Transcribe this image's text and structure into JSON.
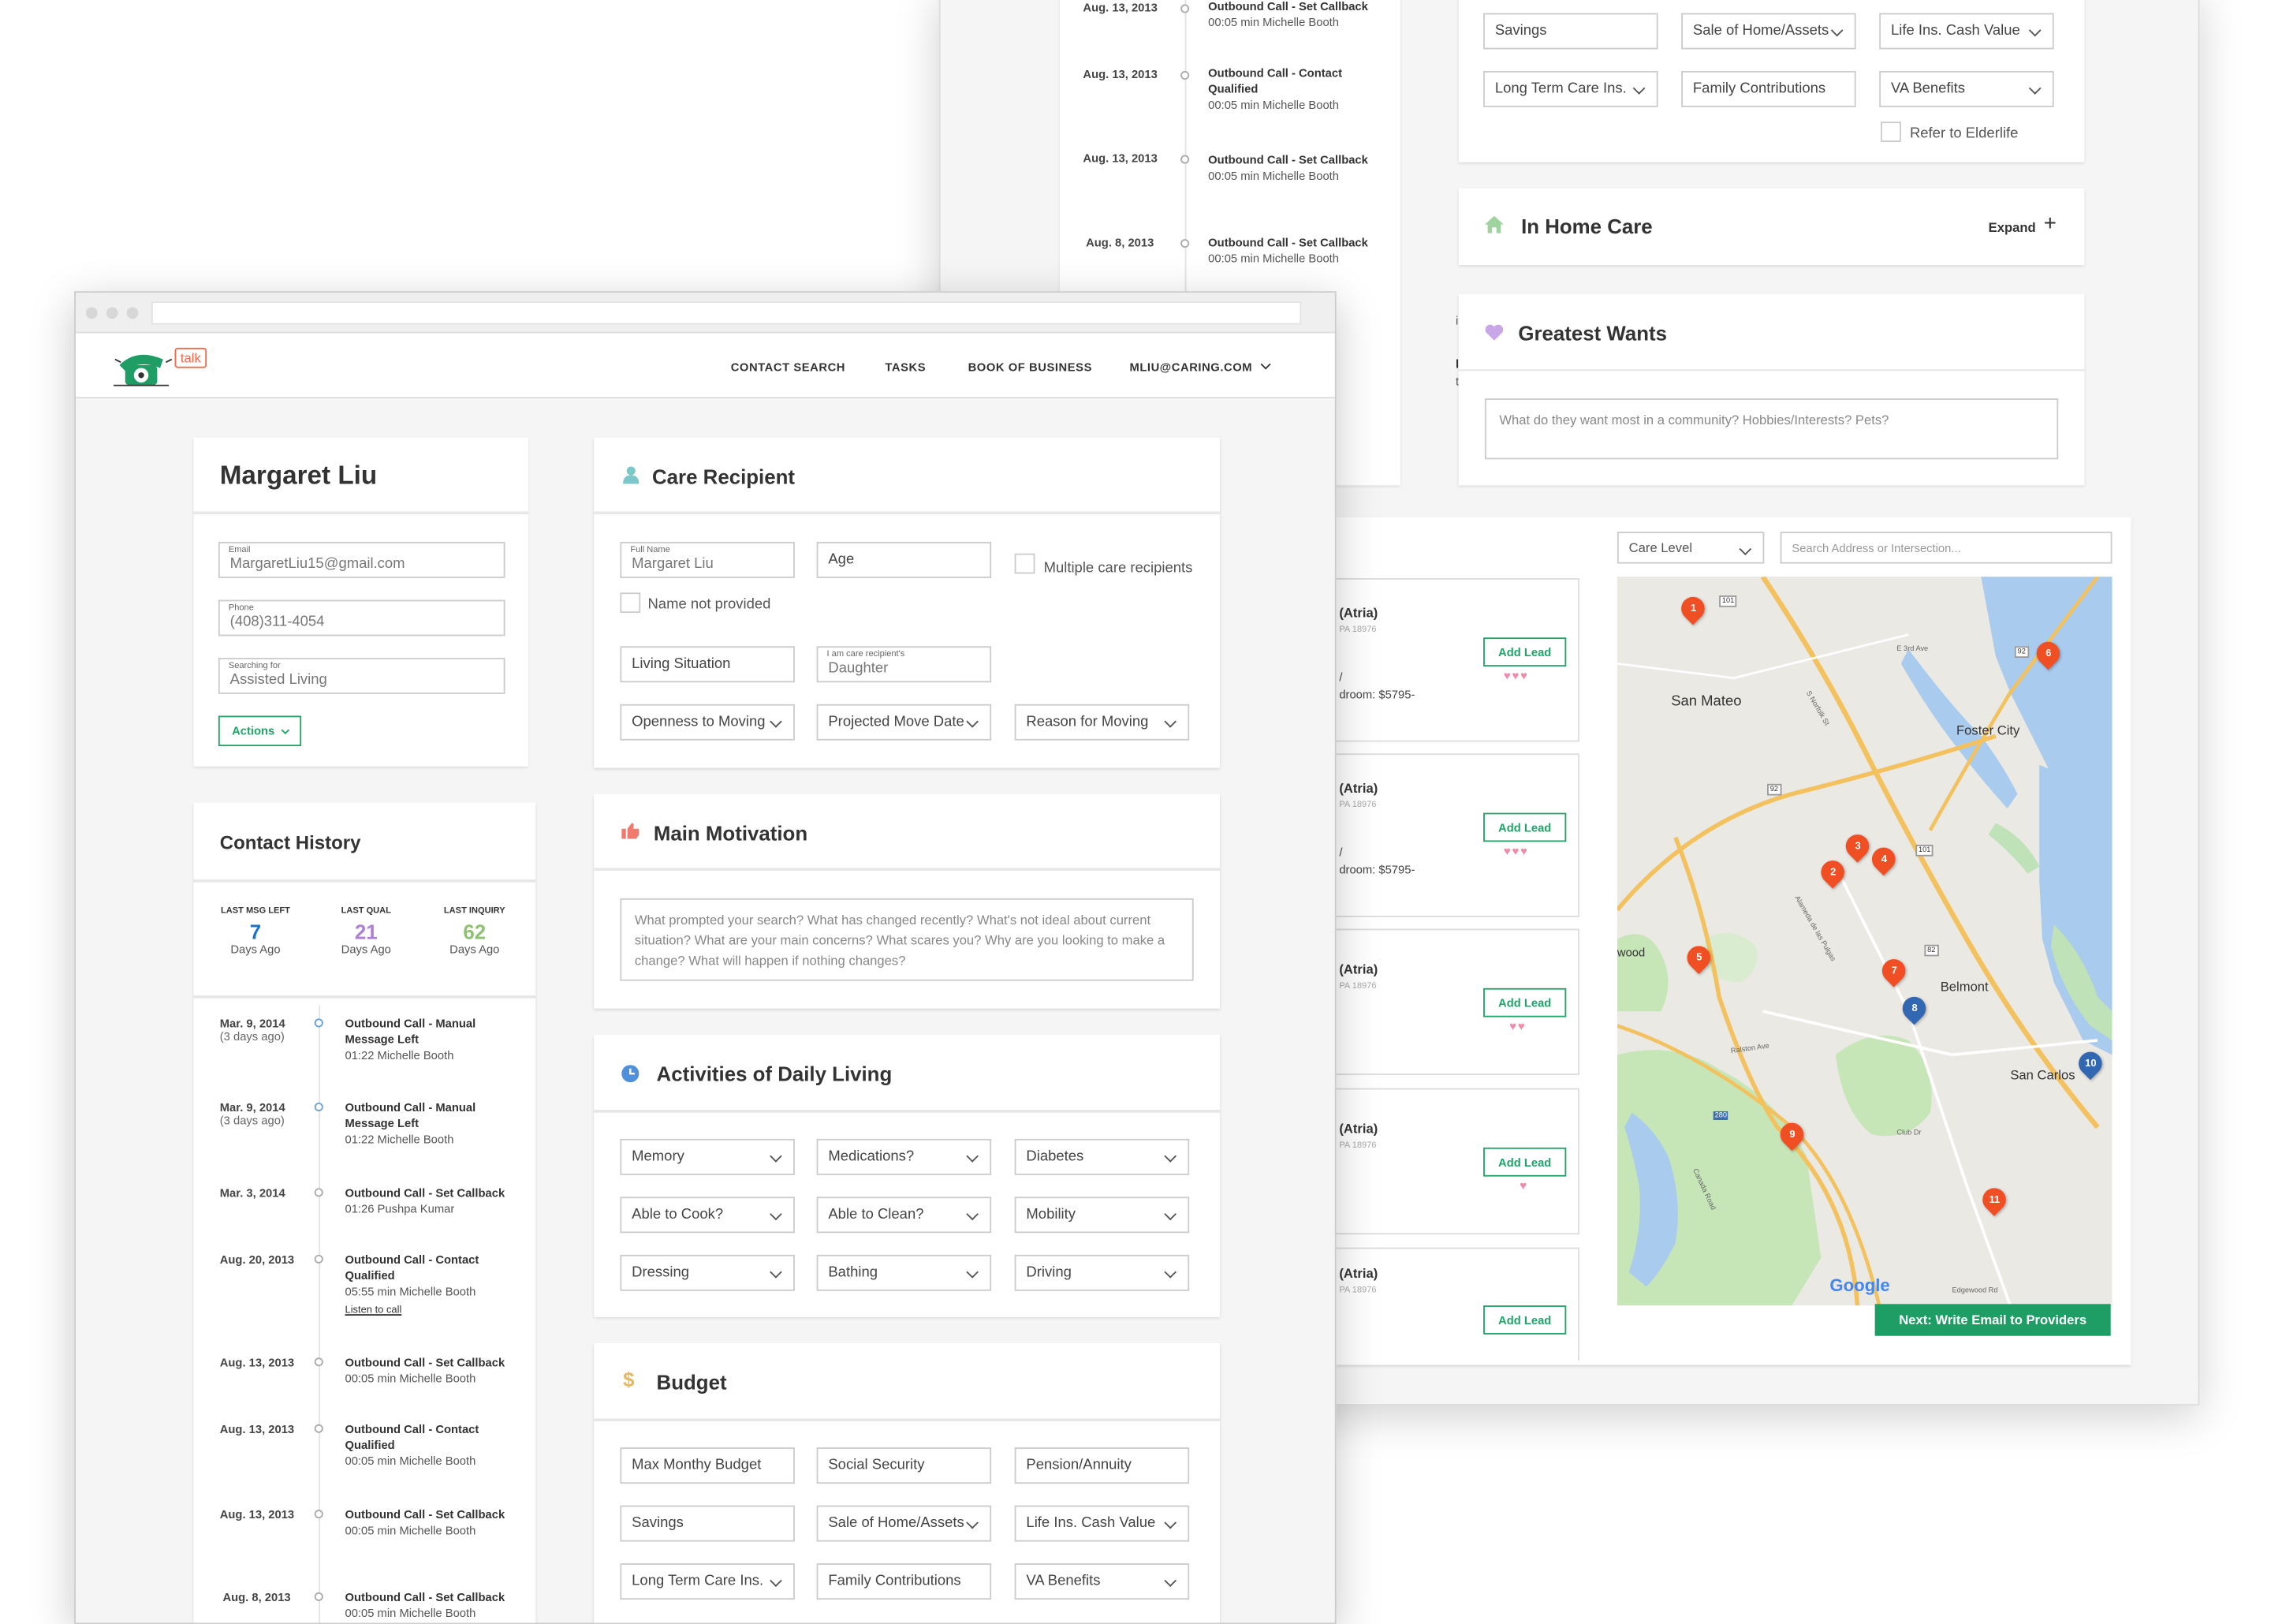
{
  "back": {
    "timeline": [
      {
        "date": "Aug. 13, 2013",
        "title": "Outbound Call - Set Callback",
        "meta": "00:05 min Michelle Booth"
      },
      {
        "date": "Aug. 13, 2013",
        "title": "Outbound Call - Contact Qualified",
        "meta": "00:05 min Michelle Booth"
      },
      {
        "date": "Aug. 13, 2013",
        "title": "Outbound Call - Set Callback",
        "meta": "00:05 min Michelle Booth"
      },
      {
        "date": "Aug. 8, 2013",
        "title": "Outbound Call - Set Callback",
        "meta": "00:05 min Michelle Booth"
      }
    ],
    "partial_text_1": "ific",
    "partial_text_2": "llback",
    "partial_text_3": "th",
    "budget_fields": {
      "savings": "Savings",
      "sale_of_home": "Sale of Home/Assets",
      "life_ins": "Life Ins. Cash Value",
      "ltc": "Long Term Care Ins.",
      "family": "Family Contributions",
      "va": "VA Benefits"
    },
    "refer_label": "Refer to Elderlife",
    "in_home_care": {
      "title": "In Home Care",
      "expand": "Expand"
    },
    "greatest_wants": {
      "title": "Greatest Wants",
      "placeholder": "What do they want most in a community? Hobbies/Interests? Pets?"
    },
    "care_level": "Care Level",
    "search_placeholder": "Search Address or Intersection...",
    "providers": [
      {
        "name": "(Atria)",
        "sub": "PA 18976",
        "price_1": "/",
        "price_2": "droom: $5795-",
        "hearts": "♥♥♥",
        "add": "Add Lead"
      },
      {
        "name": "(Atria)",
        "sub": "PA 18976",
        "price_1": "/",
        "price_2": "droom: $5795-",
        "hearts": "♥♥♥",
        "add": "Add Lead"
      },
      {
        "name": "(Atria)",
        "sub": "PA 18976",
        "price_1": "",
        "price_2": "",
        "hearts": "♥♥",
        "add": "Add Lead"
      },
      {
        "name": "(Atria)",
        "sub": "PA 18976",
        "price_1": "",
        "price_2": "",
        "hearts": "♥",
        "add": "Add Lead"
      },
      {
        "name": "(Atria)",
        "sub": "PA 18976",
        "price_1": "",
        "price_2": "",
        "hearts": "",
        "add": "Add Lead"
      }
    ],
    "map": {
      "labels": {
        "san_mateo": "San Mateo",
        "foster_city": "Foster City",
        "belmont": "Belmont",
        "san_carlos": "San Carlos",
        "wood": "wood",
        "google": "Google"
      },
      "roads": {
        "e3rd": "E 3rd Ave",
        "r101": "101",
        "r92": "92",
        "r82": "82",
        "r280": "280",
        "alameda": "Alameda de las Pulgas",
        "ralston": "Ralston Ave",
        "club": "Club Dr",
        "canada": "Canada Road",
        "edgewood": "Edgewood Rd",
        "norfolk": "S Norfolk St"
      },
      "pins": [
        "1",
        "2",
        "3",
        "4",
        "5",
        "6",
        "7",
        "8",
        "9",
        "10",
        "11"
      ]
    },
    "next_button": "Next: Write Email to Providers"
  },
  "front": {
    "nav": {
      "logo_text": "talk",
      "links": [
        "CONTACT SEARCH",
        "TASKS",
        "BOOK OF BUSINESS",
        "MLIU@CARING.COM"
      ]
    },
    "contact": {
      "name": "Margaret Liu",
      "email_label": "Email",
      "email": "MargaretLiu15@gmail.com",
      "phone_label": "Phone",
      "phone": "(408)311-4054",
      "searching_label": "Searching for",
      "searching": "Assisted Living",
      "actions": "Actions"
    },
    "history": {
      "title": "Contact History",
      "stats": [
        {
          "label": "LAST MSG LEFT",
          "value": "7",
          "unit": "Days Ago",
          "color": "#1a73c8"
        },
        {
          "label": "LAST QUAL",
          "value": "21",
          "unit": "Days Ago",
          "color": "#b07ed8"
        },
        {
          "label": "LAST INQUIRY",
          "value": "62",
          "unit": "Days Ago",
          "color": "#8dc26f"
        }
      ],
      "items": [
        {
          "date": "Mar. 9, 2014",
          "sub": "(3 days ago)",
          "title": "Outbound Call - Manual Message Left",
          "meta": "01:22 Michelle Booth",
          "link": ""
        },
        {
          "date": "Mar. 9, 2014",
          "sub": "(3 days ago)",
          "title": "Outbound Call - Manual Message Left",
          "meta": "01:22 Michelle Booth",
          "link": ""
        },
        {
          "date": "Mar. 3, 2014",
          "sub": "",
          "title": "Outbound Call - Set Callback",
          "meta": "01:26 Pushpa Kumar",
          "link": ""
        },
        {
          "date": "Aug. 20, 2013",
          "sub": "",
          "title": "Outbound Call - Contact Qualified",
          "meta": "05:55 min Michelle Booth",
          "link": "Listen to call"
        },
        {
          "date": "Aug. 13, 2013",
          "sub": "",
          "title": "Outbound Call - Set Callback",
          "meta": "00:05 min Michelle Booth",
          "link": ""
        },
        {
          "date": "Aug. 13, 2013",
          "sub": "",
          "title": "Outbound Call - Contact Qualified",
          "meta": "00:05 min Michelle Booth",
          "link": ""
        },
        {
          "date": "Aug. 13, 2013",
          "sub": "",
          "title": "Outbound Call - Set Callback",
          "meta": "00:05 min Michelle Booth",
          "link": ""
        },
        {
          "date": "Aug. 8, 2013",
          "sub": "",
          "title": "Outbound Call - Set Callback",
          "meta": "00:05 min Michelle Booth",
          "link": ""
        }
      ]
    },
    "care_recipient": {
      "title": "Care Recipient",
      "full_name_label": "Full Name",
      "full_name": "Margaret Liu",
      "age": "Age",
      "multiple": "Multiple care recipients",
      "name_not_provided": "Name not provided",
      "living_situation": "Living Situation",
      "relation_label": "I am care recipient's",
      "relation": "Daughter",
      "openness": "Openness to Moving",
      "move_date": "Projected Move Date",
      "reason": "Reason for Moving"
    },
    "motivation": {
      "title": "Main Motivation",
      "placeholder": "What prompted your search? What has changed recently? What's not ideal about current situation? What are your main concerns? What scares you? Why are you looking to make a change? What will happen if nothing changes?"
    },
    "adl": {
      "title": "Activities of Daily Living",
      "fields": [
        "Memory",
        "Medications?",
        "Diabetes",
        "Able to Cook?",
        "Able to Clean?",
        "Mobility",
        "Dressing",
        "Bathing",
        "Driving"
      ]
    },
    "budget": {
      "title": "Budget",
      "fields": [
        "Max Monthy Budget",
        "Social Security",
        "Pension/Annuity",
        "Savings",
        "Sale of Home/Assets",
        "Life Ins. Cash Value",
        "Long Term Care Ins.",
        "Family Contributions",
        "VA Benefits"
      ]
    }
  }
}
